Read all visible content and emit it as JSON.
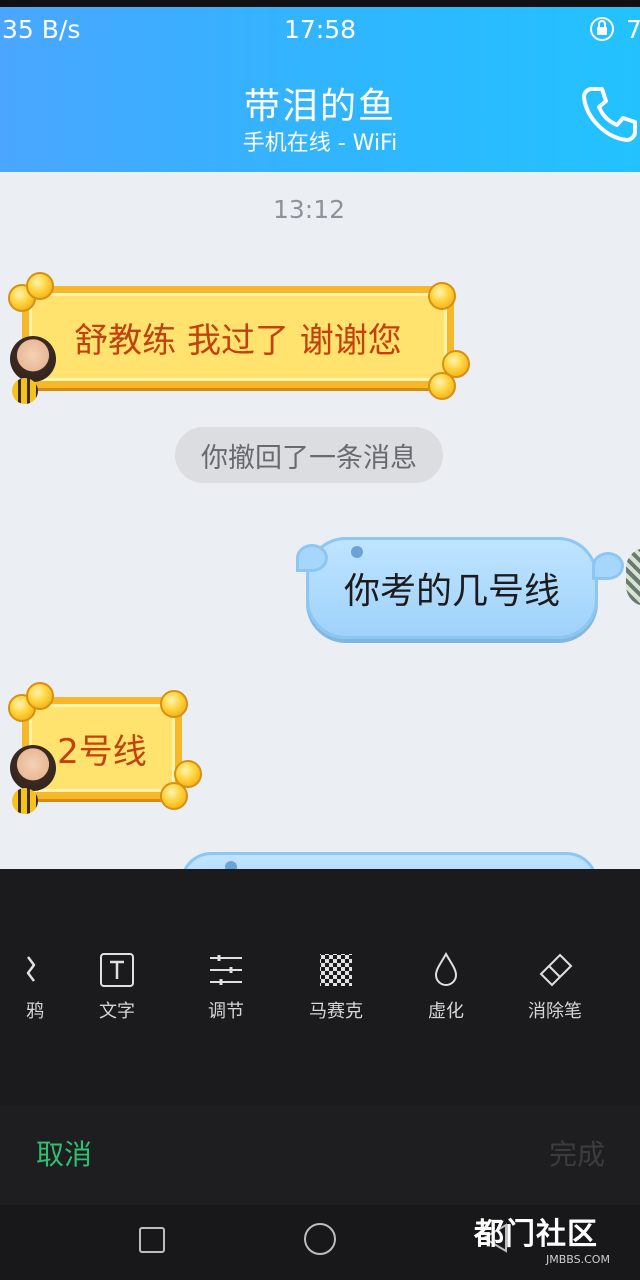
{
  "status_bar": {
    "speed": "35 B/s",
    "time": "17:58",
    "battery": "7"
  },
  "header": {
    "contact_name": "带泪的鱼",
    "presence": "手机在线 - WiFi"
  },
  "chat": {
    "timestamp": "13:12",
    "messages": [
      {
        "side": "left",
        "text": "舒教练 我过了 谢谢您"
      },
      {
        "side": "system",
        "text": "你撤回了一条消息"
      },
      {
        "side": "right",
        "text": "你考的几号线"
      },
      {
        "side": "left",
        "text": "2号线"
      }
    ]
  },
  "editor": {
    "tools": [
      {
        "icon": "scribble-icon",
        "label": "鸦"
      },
      {
        "icon": "text-icon",
        "label": "文字"
      },
      {
        "icon": "adjust-icon",
        "label": "调节"
      },
      {
        "icon": "mosaic-icon",
        "label": "马赛克"
      },
      {
        "icon": "blur-icon",
        "label": "虚化"
      },
      {
        "icon": "eraser-icon",
        "label": "消除笔"
      }
    ],
    "cancel_label": "取消",
    "done_label": "完成"
  },
  "watermark": {
    "text": "都门社区",
    "sub": "JMBBS.COM"
  },
  "colors": {
    "header_start": "#4aa6ff",
    "header_end": "#23c2ff",
    "cancel": "#2fbf71",
    "editor_bg": "#1b1b1d"
  }
}
